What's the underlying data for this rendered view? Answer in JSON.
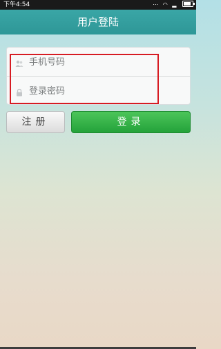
{
  "status_bar": {
    "time": "下午4:54",
    "battery_level": 0.85,
    "icons": [
      "signal-icon",
      "wifi-icon",
      "signal-bars-icon",
      "battery-icon"
    ]
  },
  "header": {
    "title": "用户登陆"
  },
  "form": {
    "phone": {
      "placeholder": "手机号码",
      "value": "",
      "icon": "user-icon"
    },
    "password": {
      "placeholder": "登录密码",
      "value": "",
      "icon": "lock-icon"
    }
  },
  "buttons": {
    "register_label": "注册",
    "login_label": "登录"
  },
  "colors": {
    "header": "#2e9797",
    "login_button": "#24a23a",
    "highlight": "#d71c23"
  }
}
